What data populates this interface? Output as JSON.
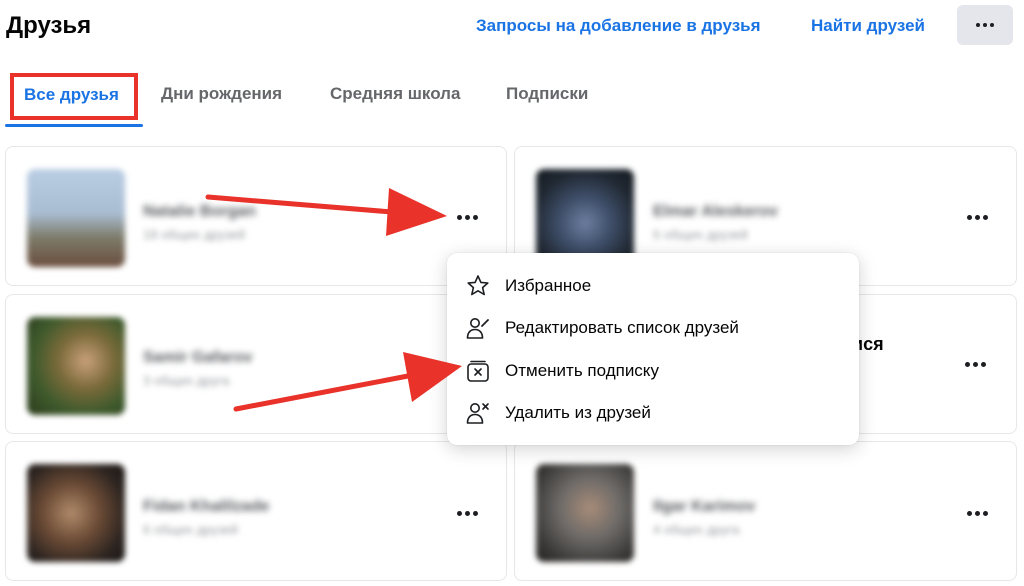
{
  "header": {
    "title": "Друзья",
    "friend_requests_link": "Запросы на добавление в друзья",
    "find_friends_link": "Найти друзей",
    "more_icon": "more-horizontal-icon"
  },
  "tabs": [
    {
      "label": "Все друзья",
      "active": true
    },
    {
      "label": "Дни рождения",
      "active": false
    },
    {
      "label": "Средняя школа",
      "active": false
    },
    {
      "label": "Подписки",
      "active": false
    }
  ],
  "friends": [
    {
      "name": "Natalie Borgan",
      "subtitle": "18 общих друзей"
    },
    {
      "name": "Elmar Aleskerov",
      "subtitle": "6 общих друзей"
    },
    {
      "name": "Samir Gafarov",
      "subtitle": "3 общих друга"
    },
    {
      "name": "",
      "subtitle": ""
    },
    {
      "name": "Fidan Khalilzade",
      "subtitle": "6 общих друзей"
    },
    {
      "name": "Ilgar Karimov",
      "subtitle": "4 общих друга"
    }
  ],
  "partial_text": "ися",
  "context_menu": {
    "items": [
      {
        "label": "Избранное",
        "icon": "star-icon"
      },
      {
        "label": "Редактировать список друзей",
        "icon": "edit-friend-list-icon"
      },
      {
        "label": "Отменить подписку",
        "icon": "unfollow-icon"
      },
      {
        "label": "Удалить из друзей",
        "icon": "remove-friend-icon"
      }
    ]
  },
  "colors": {
    "accent": "#1b74e4",
    "annotation_red": "#e8322a",
    "more_button_bg": "#e4e6eb"
  }
}
